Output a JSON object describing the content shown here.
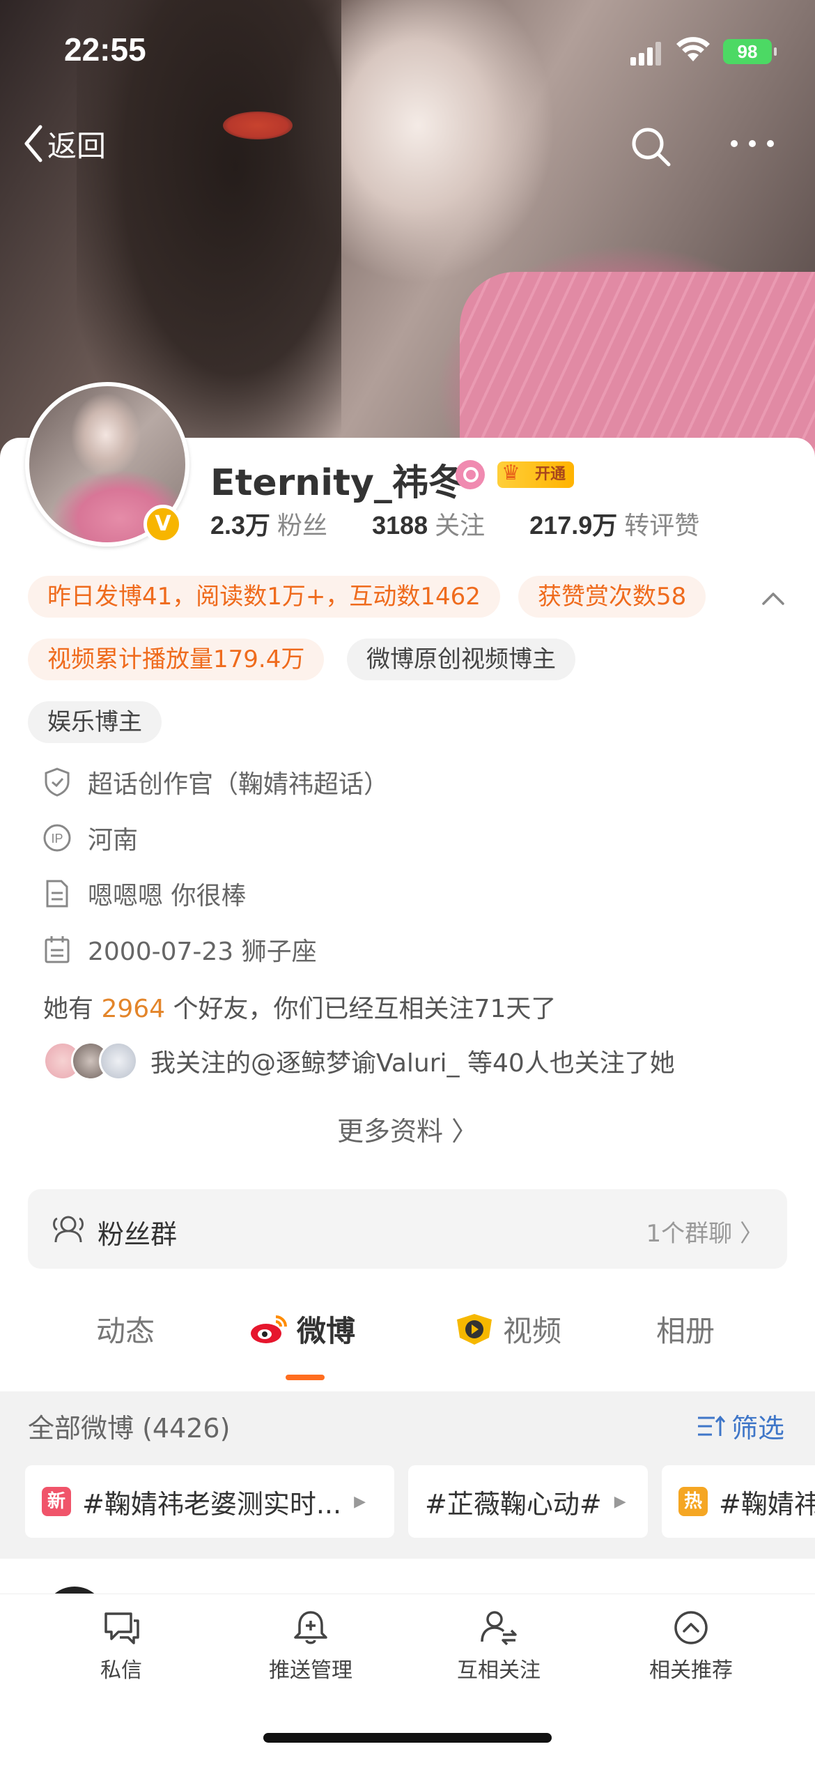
{
  "status_bar": {
    "time": "22:55",
    "battery": "98"
  },
  "nav": {
    "back_label": "返回"
  },
  "profile": {
    "name": "Eternity_祎冬",
    "vip_label": "开通",
    "verified_mark": "V",
    "stats": [
      {
        "value": "2.3万",
        "label": "粉丝"
      },
      {
        "value": "3188",
        "label": "关注"
      },
      {
        "value": "217.9万",
        "label": "转评赞"
      }
    ]
  },
  "tags": {
    "row1": [
      "昨日发博41，阅读数1万+，互动数1462",
      "获赞赏次数58"
    ],
    "row2": [
      "视频累计播放量179.4万",
      "微博原创视频博主"
    ],
    "row3": [
      "娱乐博主"
    ]
  },
  "info": {
    "supertopic": "超话创作官（鞠婧祎超话）",
    "ip": "河南",
    "bio": "嗯嗯嗯 你很棒",
    "birthday": "2000-07-23 狮子座"
  },
  "friends": {
    "prefix": "她有",
    "count": "2964",
    "suffix": "个好友，你们已经互相关注71天了"
  },
  "mutual": {
    "text": "我关注的@逐鲸梦谕Valuri_ 等40人也关注了她"
  },
  "more_label": "更多资料 〉",
  "fan_group": {
    "label": "粉丝群",
    "right": "1个群聊 〉"
  },
  "tabs": [
    "动态",
    "微博",
    "视频",
    "相册"
  ],
  "feed": {
    "count_label": "全部微博 (4426)",
    "filter_label": "筛选",
    "topics": [
      {
        "badge": "新",
        "badge_color": "#f0546a",
        "text": "#鞠婧祎老婆测实时..."
      },
      {
        "badge": "",
        "badge_color": "",
        "text": "#芷薇鞠心动#"
      },
      {
        "badge": "热",
        "badge_color": "#f5a623",
        "text": "#鞠婧祎"
      }
    ]
  },
  "bottom_bar": [
    "私信",
    "推送管理",
    "互相关注",
    "相关推荐"
  ],
  "colors": {
    "accent": "#ff6d1f",
    "orange_tag_text": "#ef6b1d",
    "link_blue": "#3f76c8"
  }
}
